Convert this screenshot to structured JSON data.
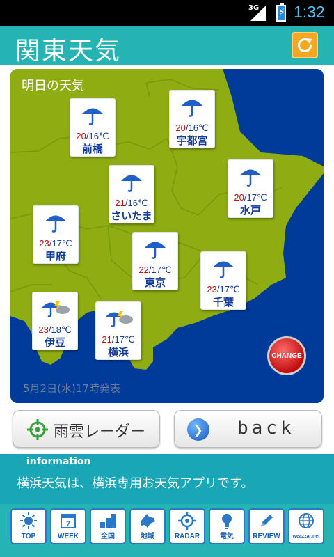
{
  "status_bar": {
    "network": "3G",
    "time": "1:32"
  },
  "header": {
    "title": "関東天気",
    "refresh_icon": "refresh-icon"
  },
  "map": {
    "title": "明日の天気",
    "footnote": "5月2日(水)17時発表",
    "change_label": "CHANGE",
    "colors": {
      "sea": "#003b9a",
      "land": "#8fad12",
      "border": "#7d9a0d"
    },
    "cities": [
      {
        "name": "前橋",
        "high": "20",
        "low": "16",
        "unit": "℃",
        "icon": "umbrella-icon"
      },
      {
        "name": "宇都宮",
        "high": "20",
        "low": "16",
        "unit": "℃",
        "icon": "umbrella-icon"
      },
      {
        "name": "さいたま",
        "high": "21",
        "low": "16",
        "unit": "℃",
        "icon": "umbrella-icon"
      },
      {
        "name": "水戸",
        "high": "20",
        "low": "17",
        "unit": "℃",
        "icon": "umbrella-icon"
      },
      {
        "name": "甲府",
        "high": "23",
        "low": "17",
        "unit": "℃",
        "icon": "umbrella-icon"
      },
      {
        "name": "東京",
        "high": "22",
        "low": "17",
        "unit": "℃",
        "icon": "umbrella-icon"
      },
      {
        "name": "千葉",
        "high": "23",
        "low": "17",
        "unit": "℃",
        "icon": "umbrella-icon"
      },
      {
        "name": "伊豆",
        "high": "23",
        "low": "18",
        "unit": "℃",
        "icon": "umbrella-thunder-icon"
      },
      {
        "name": "横浜",
        "high": "21",
        "low": "17",
        "unit": "℃",
        "icon": "umbrella-thunder-icon"
      }
    ]
  },
  "buttons": {
    "radar_label": "雨雲レーダー",
    "back_label": "back"
  },
  "info": {
    "heading": "information",
    "text": "横浜天気は、横浜専用お天気アプリです。"
  },
  "nav": [
    {
      "label": "TOP",
      "icon": "sun-icon"
    },
    {
      "label": "WEEK",
      "icon": "calendar-icon",
      "badge": "7"
    },
    {
      "label": "全国",
      "icon": "japan-bars-icon"
    },
    {
      "label": "地域",
      "icon": "hokkaido-icon"
    },
    {
      "label": "RADAR",
      "icon": "radar-icon"
    },
    {
      "label": "電気",
      "icon": "lightbulb-icon"
    },
    {
      "label": "REVIEW",
      "icon": "pencil-icon"
    },
    {
      "label": "weazzar.net",
      "icon": "globe-icon"
    }
  ]
}
